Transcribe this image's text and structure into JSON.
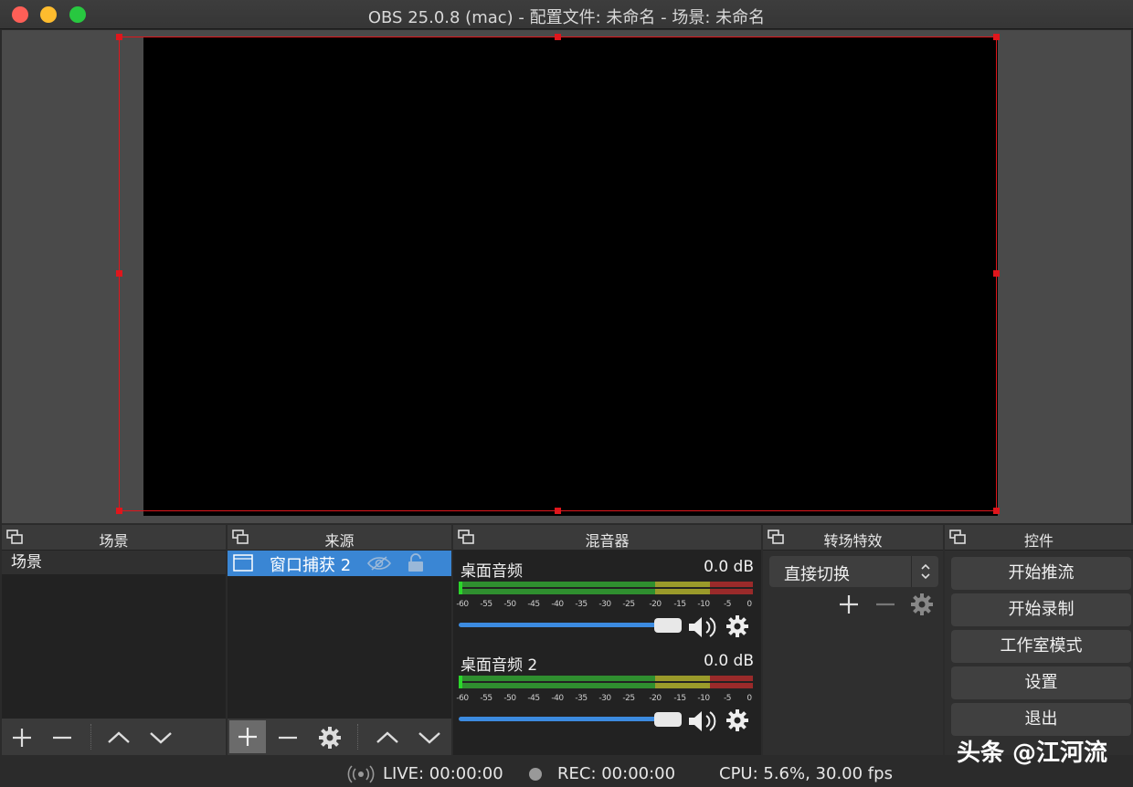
{
  "window": {
    "title": "OBS 25.0.8 (mac) - 配置文件: 未命名 - 场景: 未命名"
  },
  "docks": {
    "scenes": {
      "title": "场景",
      "items": [
        "场景"
      ]
    },
    "sources": {
      "title": "来源",
      "items": [
        {
          "label": "窗口捕获 2",
          "icon": "window-capture-icon",
          "visible_icon": "eye-icon",
          "lock_icon": "lock-icon"
        }
      ]
    },
    "mixer": {
      "title": "混音器",
      "channels": [
        {
          "name": "桌面音频",
          "db": "0.0 dB"
        },
        {
          "name": "桌面音频 2",
          "db": "0.0 dB"
        }
      ],
      "tick_labels": [
        "-60",
        "-55",
        "-50",
        "-45",
        "-40",
        "-35",
        "-30",
        "-25",
        "-20",
        "-15",
        "-10",
        "-5",
        "0"
      ],
      "colors": {
        "green": "#2f8f2f",
        "yellow": "#9a9a2a",
        "red": "#9a2a2a",
        "volume": "#3c8be0"
      }
    },
    "transitions": {
      "title": "转场特效",
      "selected": "直接切换"
    },
    "controls": {
      "title": "控件",
      "buttons": [
        "开始推流",
        "开始录制",
        "工作室模式",
        "设置",
        "退出"
      ]
    }
  },
  "statusbar": {
    "live": "LIVE: 00:00:00",
    "rec": "REC: 00:00:00",
    "cpu": "CPU: 5.6%, 30.00 fps"
  },
  "watermark": "头条 @江河流",
  "colors": {
    "selection": "#e0161c",
    "source_highlight": "#3a86d4"
  }
}
